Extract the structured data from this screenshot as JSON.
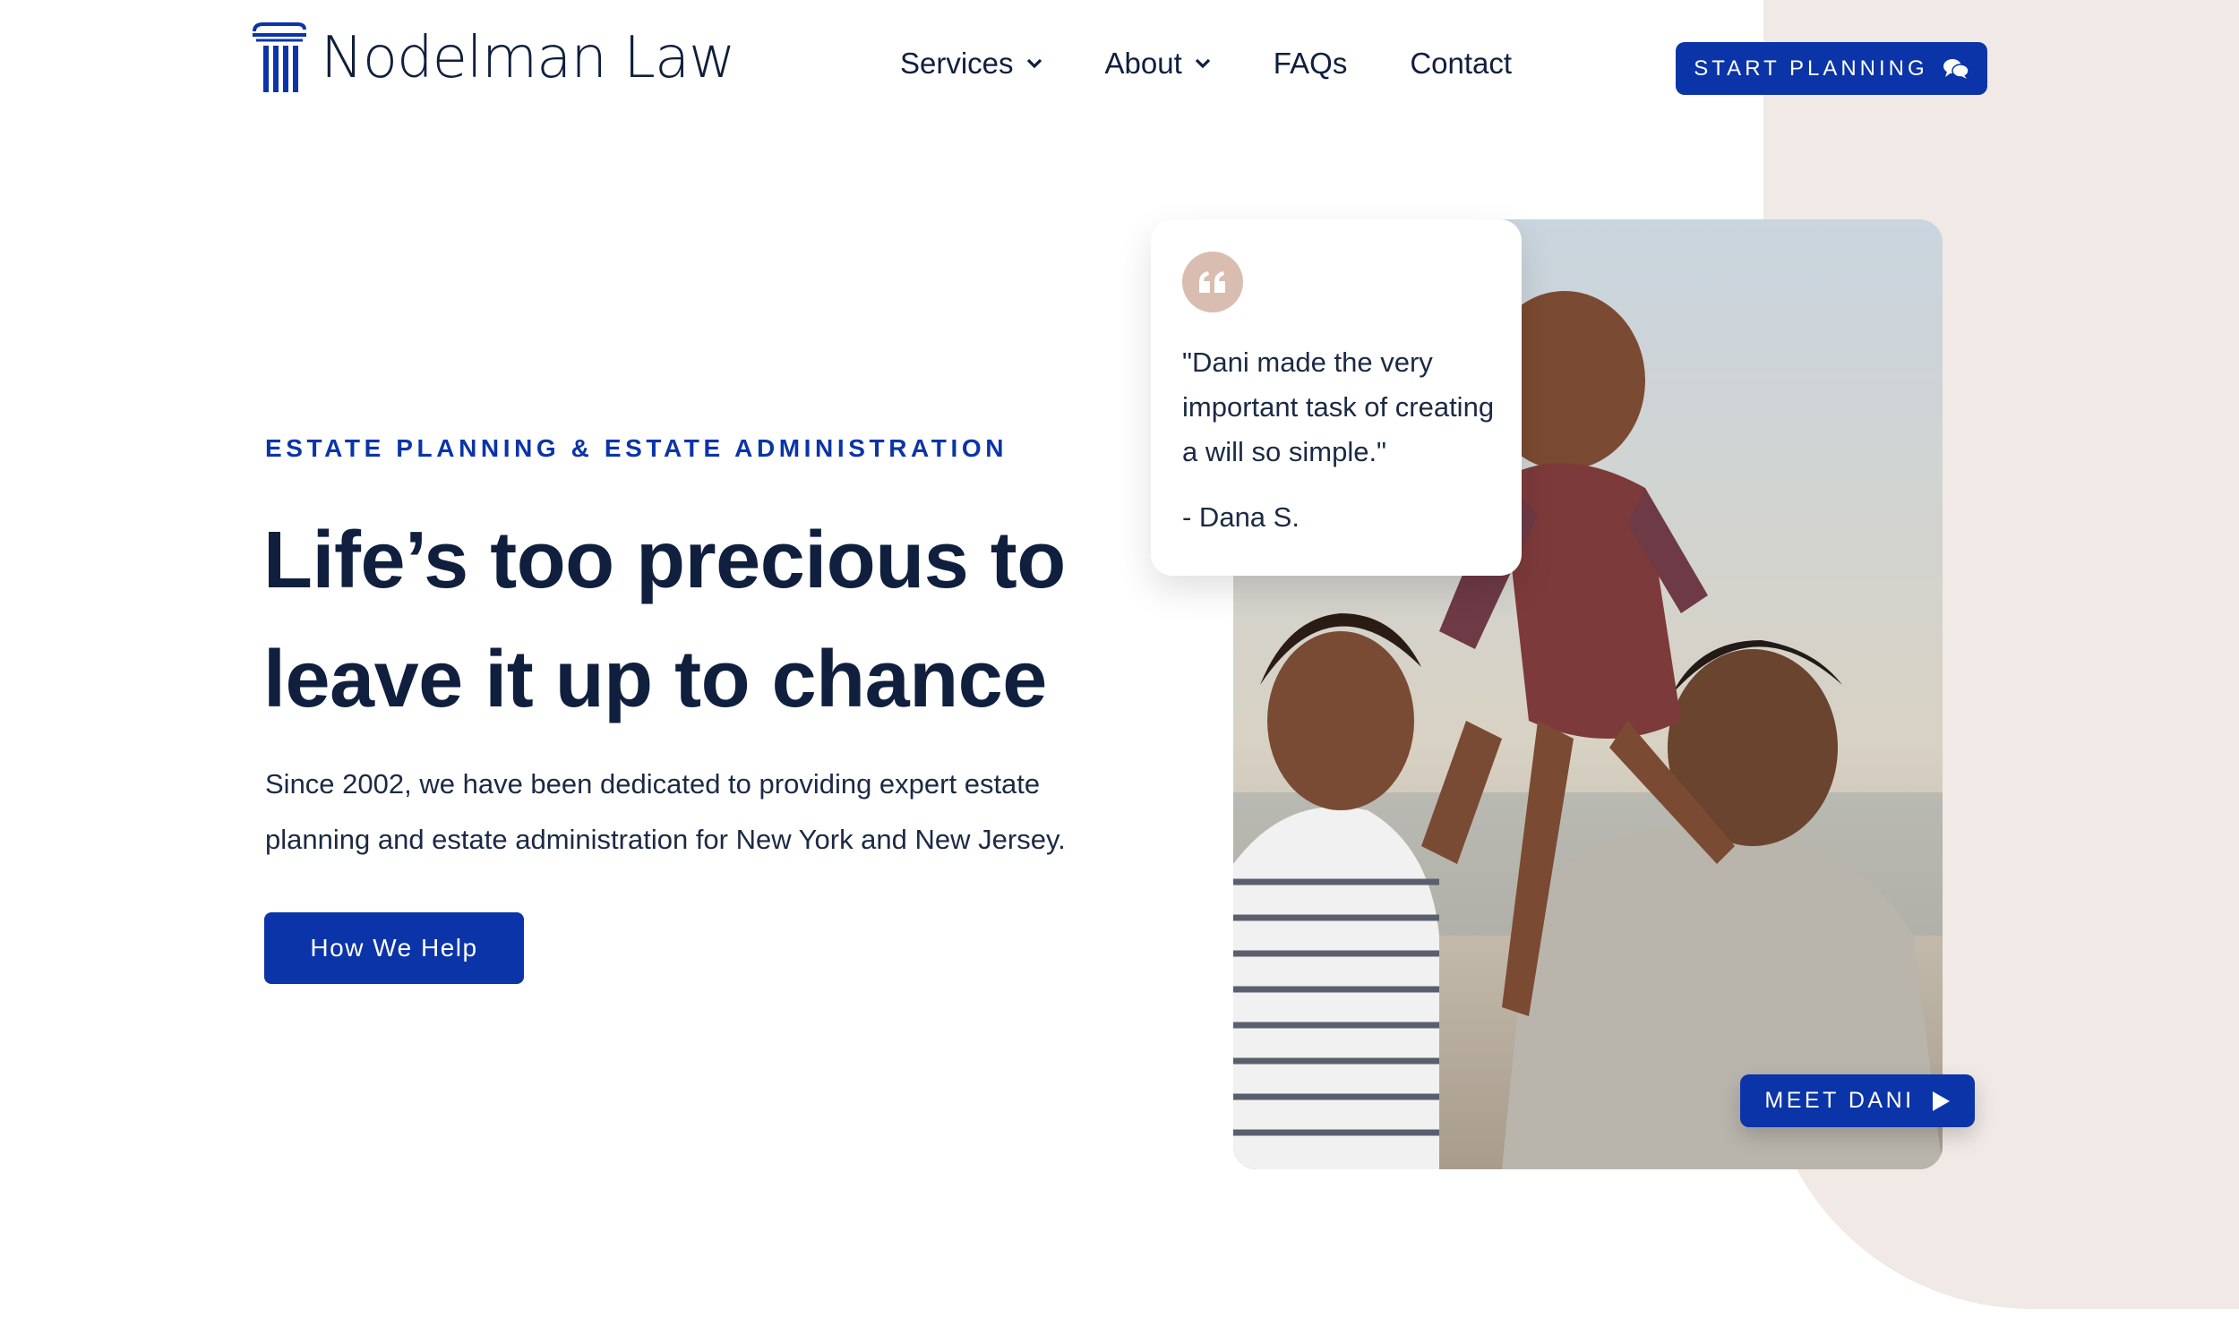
{
  "brand": {
    "name": "Nodelman Law",
    "logo_icon": "column-icon"
  },
  "nav": {
    "items": [
      {
        "label": "Services",
        "has_dropdown": true
      },
      {
        "label": "About",
        "has_dropdown": true
      },
      {
        "label": "FAQs",
        "has_dropdown": false
      },
      {
        "label": "Contact",
        "has_dropdown": false
      }
    ],
    "cta_label": "START PLANNING",
    "cta_icon": "chat-bubbles-icon"
  },
  "hero": {
    "eyebrow": "ESTATE PLANNING & ESTATE ADMINISTRATION",
    "headline_line1": "Life’s too precious to",
    "headline_line2": "leave it up to chance",
    "subtext_line1": "Since 2002, we have been dedicated to providing expert estate",
    "subtext_line2": "planning and estate administration for New York and New Jersey.",
    "button_label": "How We Help"
  },
  "testimonial": {
    "quote_line1": "\"Dani made the very",
    "quote_line2": "important task of creating",
    "quote_line3": "a will so simple.\"",
    "author": "- Dana S."
  },
  "video": {
    "button_label": "MEET DANI",
    "icon": "play-icon"
  },
  "colors": {
    "accent": "#0b34a8",
    "navy": "#0f1f3d",
    "panel": "#f0e9e5",
    "quote_badge": "#d9bdb0"
  }
}
